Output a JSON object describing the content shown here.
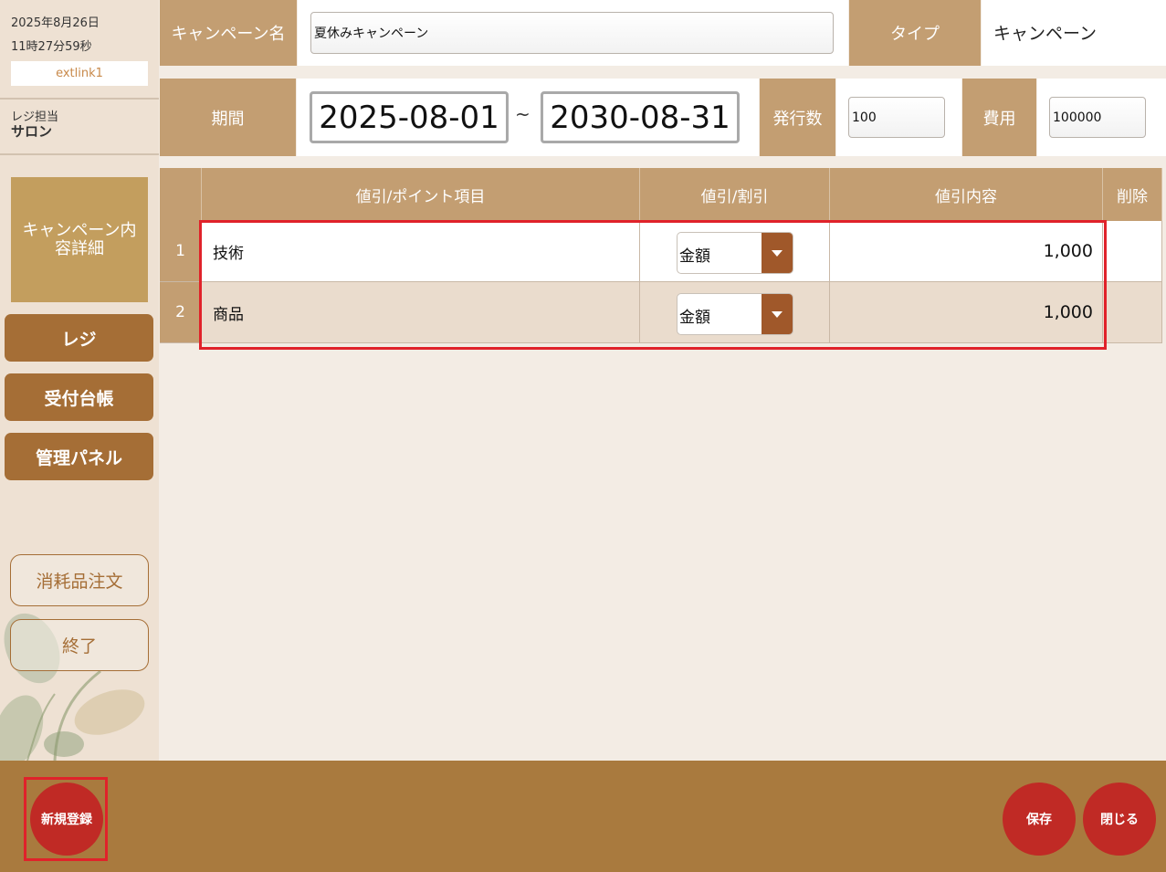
{
  "sidebar": {
    "date": "2025年8月26日",
    "time": "11時27分59秒",
    "user": "extlink1",
    "staff_label": "レジ担当",
    "staff_name": "サロン",
    "active_menu": "キャンペーン内容詳細",
    "nav": [
      {
        "label": "レジ"
      },
      {
        "label": "受付台帳"
      },
      {
        "label": "管理パネル"
      }
    ],
    "order_supplies": "消耗品注文",
    "exit": "終了"
  },
  "form": {
    "campaign_name_label": "キャンペーン名",
    "campaign_name_value": "夏休みキャンペーン",
    "type_label": "タイプ",
    "type_value": "キャンペーン",
    "period_label": "期間",
    "start_date": "2025-08-01",
    "tilde": "~",
    "end_date": "2030-08-31",
    "issue_count_label": "発行数",
    "issue_count_value": "100",
    "cost_label": "費用",
    "cost_value": "100000"
  },
  "table": {
    "headers": [
      "値引/ポイント項目",
      "値引/割引",
      "値引内容",
      "削除"
    ],
    "rows": [
      {
        "no": "1",
        "item": "技術",
        "discount_type": "金額",
        "amount": "1,000"
      },
      {
        "no": "2",
        "item": "商品",
        "discount_type": "金額",
        "amount": "1,000"
      }
    ]
  },
  "footer": {
    "new_label": "新規登録",
    "save_label": "保存",
    "close_label": "閉じる"
  },
  "colors": {
    "header_tan": "#c39e72",
    "nav_brown": "#a56e36",
    "footer_brown": "#a97a3e",
    "button_red": "#c02a25",
    "highlight_red": "#e0222a"
  }
}
